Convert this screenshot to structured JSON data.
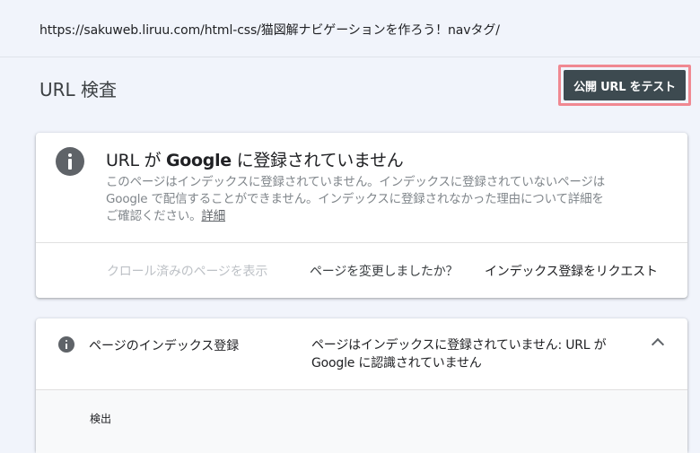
{
  "url_bar": {
    "url": "https://sakuweb.liruu.com/html-css/猫図解ナビゲーションを作ろう！navタグ/"
  },
  "header": {
    "title": "URL 検査",
    "test_button_label": "公開 URL をテスト"
  },
  "status_card": {
    "title_prefix": "URL が ",
    "title_brand": "Google",
    "title_suffix": " に登録されていません",
    "description": "このページはインデックスに登録されていません。インデックスに登録されていないページは Google で配信することができません。インデックスに登録されなかった理由について詳細をご確認ください。",
    "details_link": "詳細",
    "actions": {
      "view_crawled": "クロール済みのページを表示",
      "changed_question": "ページを変更しましたか？",
      "request_indexing": "インデックス登録をリクエスト"
    }
  },
  "indexing_card": {
    "label": "ページのインデックス登録",
    "status": "ページはインデックスに登録されていません: URL が Google に認識されていません",
    "section_label": "検出"
  },
  "colors": {
    "button_bg": "#3d4a50",
    "highlight_border": "#f08891",
    "page_bg": "#f1f4fb"
  }
}
